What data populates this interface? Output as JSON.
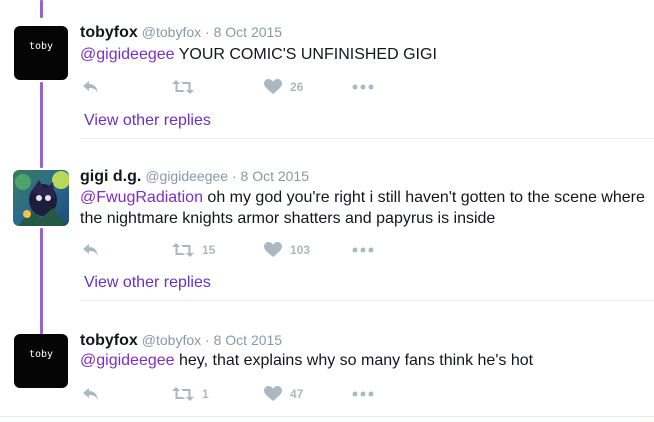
{
  "tweets": [
    {
      "avatar_text": "toby",
      "name": "tobyfox",
      "handle": "@tobyfox",
      "date": "8 Oct 2015",
      "mention": "@gigideegee",
      "text": " YOUR COMIC'S UNFINISHED GIGI",
      "retweets": "",
      "likes": "26",
      "view_replies": "View other replies"
    },
    {
      "name": "gigi d.g.",
      "handle": "@gigideegee",
      "date": "8 Oct 2015",
      "mention": "@FwugRadiation",
      "text": " oh my god you're right i still haven't gotten to the scene where",
      "text_line2": "the nightmare knights armor shatters and papyrus is inside",
      "retweets": "15",
      "likes": "103",
      "view_replies": "View other replies"
    },
    {
      "avatar_text": "toby",
      "name": "tobyfox",
      "handle": "@tobyfox",
      "date": "8 Oct 2015",
      "mention": "@gigideegee",
      "text": " hey, that explains why so many fans think he's hot",
      "retweets": "1",
      "likes": "47"
    }
  ],
  "separator": " · ",
  "icons": [
    "reply-icon",
    "retweet-icon",
    "like-icon",
    "more-icon"
  ],
  "colors": {
    "thread_line": "#9266cc",
    "mention": "#7b2fc7",
    "icon": "#aab8c2"
  }
}
